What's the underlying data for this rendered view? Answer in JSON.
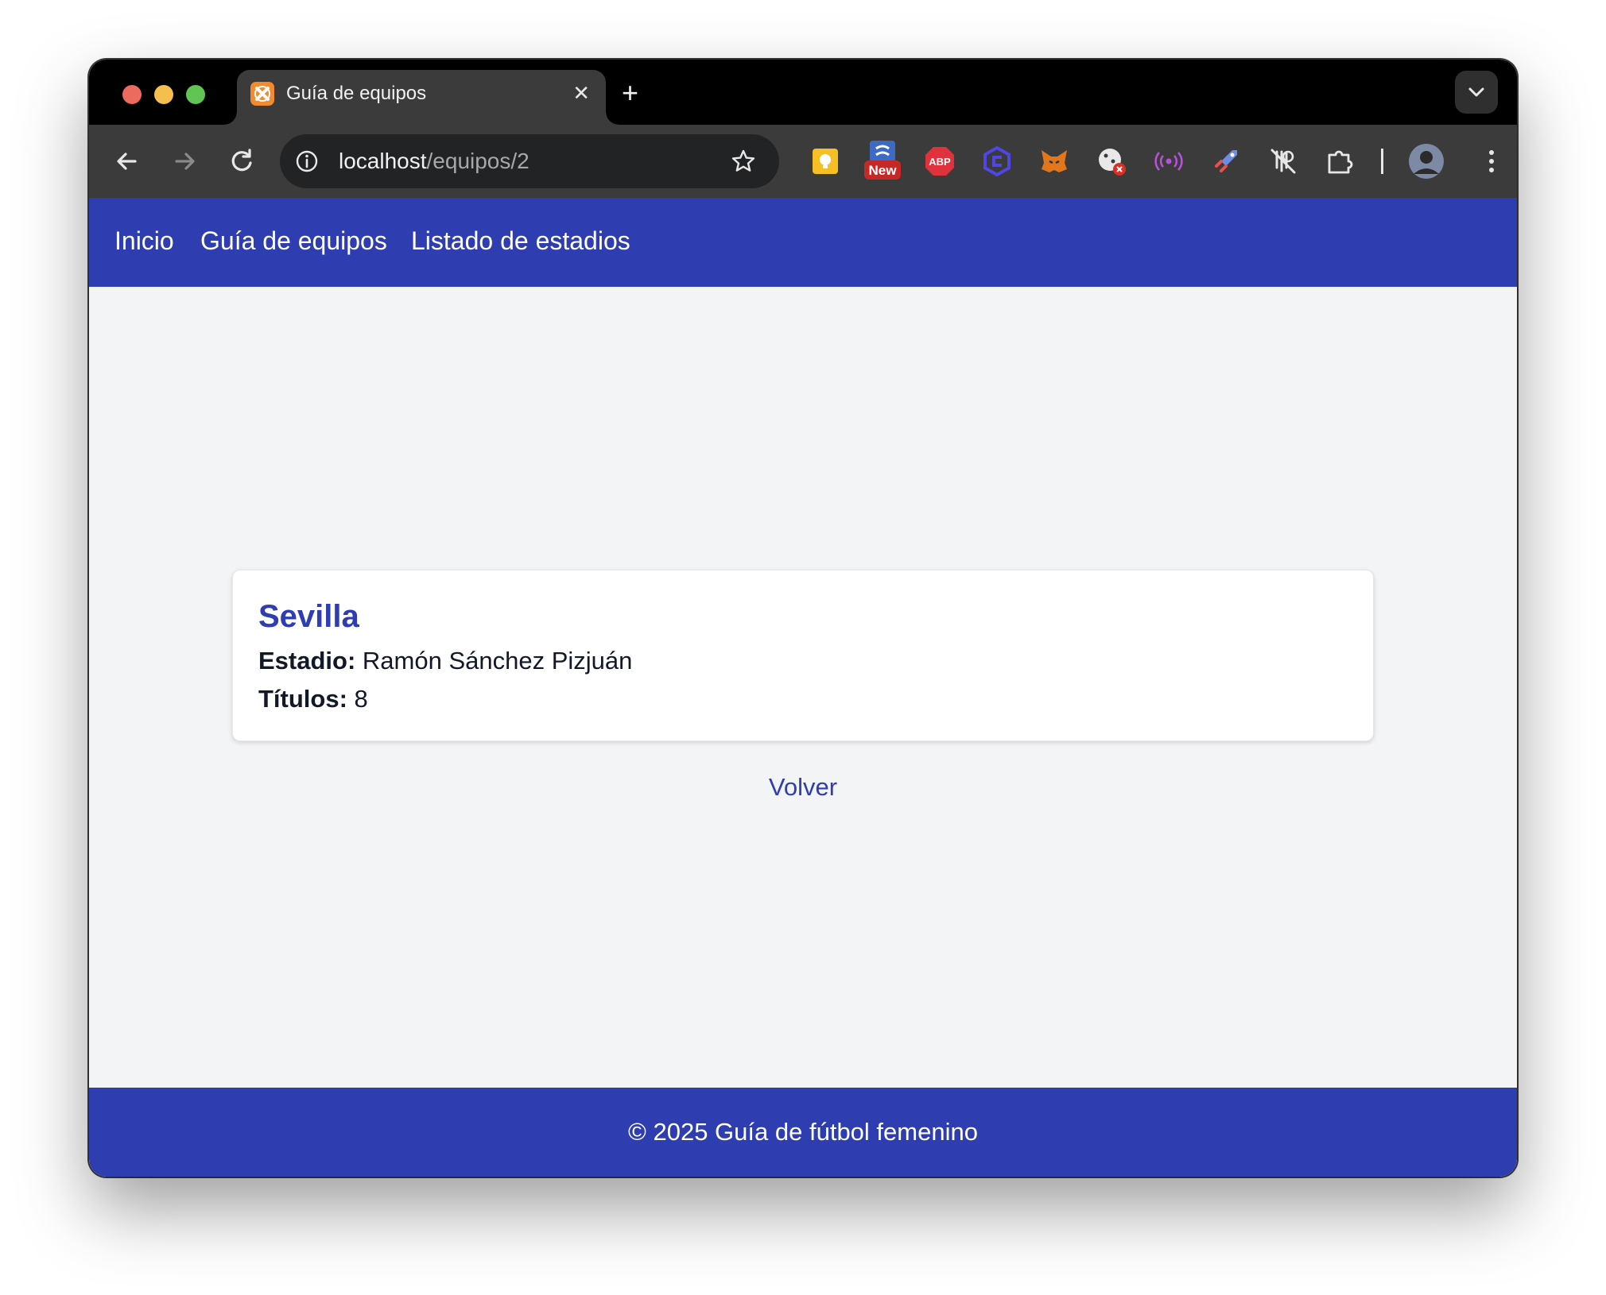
{
  "browser": {
    "tab_title": "Guía de equipos",
    "tab_close": "✕",
    "new_tab": "+",
    "url_host": "localhost",
    "url_path": "/equipos/2",
    "extensions": [
      "keep-icon",
      "new-badge-extension-icon",
      "adblock-plus-icon",
      "hexagon-extension-icon",
      "metamask-fox-icon",
      "cookie-blocker-icon",
      "wireless-extension-icon",
      "rocket-extension-icon",
      "tracker-blocker-icon",
      "extensions-puzzle-icon"
    ],
    "extension_badge": "New",
    "abp_label": "ABP"
  },
  "nav": {
    "links": [
      "Inicio",
      "Guía de equipos",
      "Listado de estadios"
    ]
  },
  "team": {
    "name": "Sevilla",
    "stadium_label": "Estadio:",
    "stadium": "Ramón Sánchez Pizjuán",
    "titles_label": "Títulos:",
    "titles": "8"
  },
  "back_link": "Volver",
  "footer": "© 2025 Guía de fútbol femenino",
  "colors": {
    "brand": "#2e3daf",
    "page_bg": "#f3f4f6",
    "card_bg": "#ffffff",
    "text": "#111827"
  }
}
